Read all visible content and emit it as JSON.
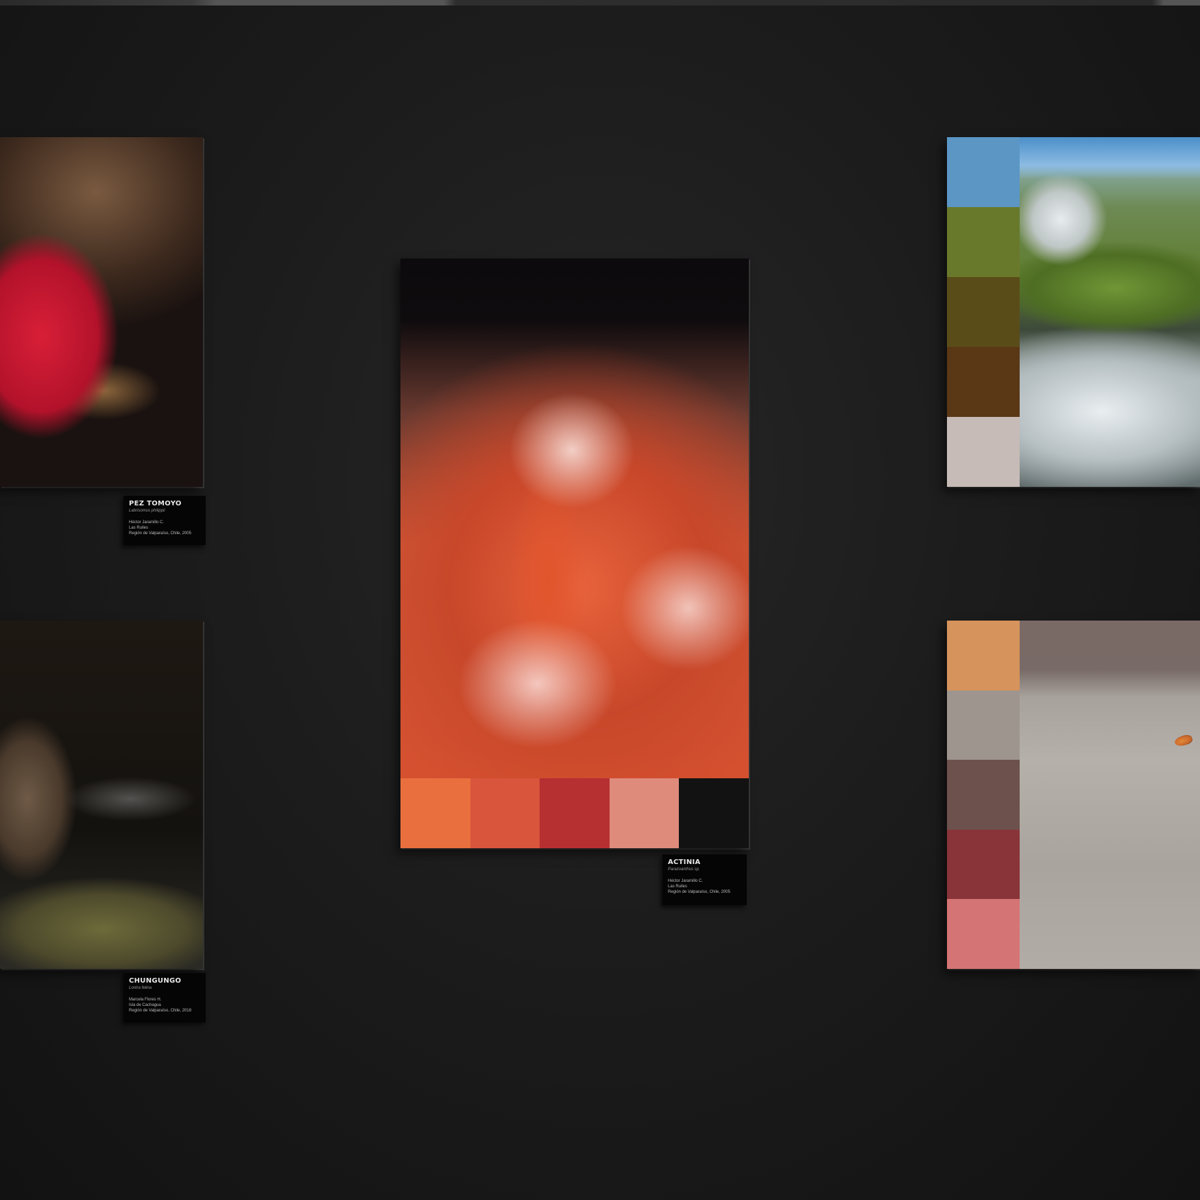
{
  "artworks": [
    {
      "id": "pez-tomoyo",
      "label": {
        "title": "PEZ TOMOYO",
        "scientific_name": "Labrisomus philippii",
        "lines": [
          "Héctor Jaramillo C.",
          "Las Ruiles",
          "Región de Valparaíso, Chile, 2005"
        ]
      }
    },
    {
      "id": "chungungo",
      "label": {
        "title": "CHUNGUNGO",
        "scientific_name": "Lontra felina",
        "lines": [
          "Marcela Flores H.",
          "Isla de Cachagua",
          "Región de Valparaíso, Chile, 2018"
        ]
      }
    },
    {
      "id": "actinia",
      "label": {
        "title": "ACTINIA",
        "scientific_name": "Parazoanthus sp.",
        "lines": [
          "Héctor Jaramillo C.",
          "Las Ruiles",
          "Región de Valparaíso, Chile, 2005"
        ]
      },
      "palette": [
        "#e9703e",
        "#d9553c",
        "#b62f31",
        "#de8b7c",
        "#121212"
      ]
    },
    {
      "id": "waterfall",
      "palette": [
        "#5b96c5",
        "#69792c",
        "#5a4c19",
        "#5a3715",
        "#c7bbb7"
      ]
    },
    {
      "id": "flamingo",
      "palette": [
        "#d6935b",
        "#9e958e",
        "#6c514c",
        "#883439",
        "#d57474"
      ]
    }
  ]
}
